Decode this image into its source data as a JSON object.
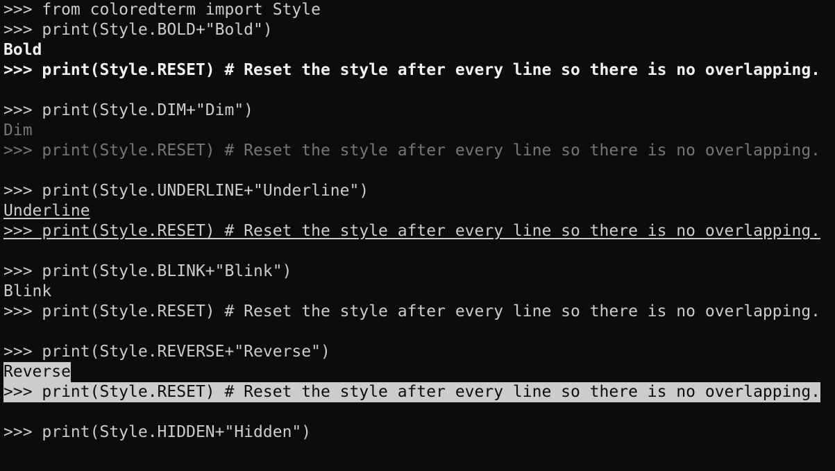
{
  "terminal": {
    "lines": [
      {
        "text": ">>> from coloredterm import Style",
        "style": "normal"
      },
      {
        "text": ">>> print(Style.BOLD+\"Bold\")",
        "style": "normal"
      },
      {
        "text": "Bold",
        "style": "bold"
      },
      {
        "text": ">>> print(Style.RESET) # Reset the style after every line so there is no overlapping.",
        "style": "bold"
      },
      {
        "text": "",
        "style": "normal"
      },
      {
        "text": ">>> print(Style.DIM+\"Dim\")",
        "style": "normal"
      },
      {
        "text": "Dim",
        "style": "dim"
      },
      {
        "text": ">>> print(Style.RESET) # Reset the style after every line so there is no overlapping.",
        "style": "dim"
      },
      {
        "text": "",
        "style": "normal"
      },
      {
        "text": ">>> print(Style.UNDERLINE+\"Underline\")",
        "style": "normal"
      },
      {
        "text": "Underline",
        "style": "underline"
      },
      {
        "text": ">>> print(Style.RESET) # Reset the style after every line so there is no overlapping.",
        "style": "underline"
      },
      {
        "text": "",
        "style": "normal"
      },
      {
        "text": ">>> print(Style.BLINK+\"Blink\")",
        "style": "normal"
      },
      {
        "text": "Blink",
        "style": "normal"
      },
      {
        "text": ">>> print(Style.RESET) # Reset the style after every line so there is no overlapping.",
        "style": "normal"
      },
      {
        "text": "",
        "style": "normal"
      },
      {
        "text": ">>> print(Style.REVERSE+\"Reverse\")",
        "style": "normal"
      },
      {
        "text": "Reverse",
        "style": "reverse"
      },
      {
        "text": ">>> print(Style.RESET) # Reset the style after every line so there is no overlapping.",
        "style": "reverse"
      },
      {
        "text": "",
        "style": "normal"
      },
      {
        "text": ">>> print(Style.HIDDEN+\"Hidden\")",
        "style": "normal"
      }
    ]
  },
  "colors": {
    "background": "#0c0c0c",
    "foreground": "#cccccc",
    "bold": "#f2f2f2",
    "dim": "#767676",
    "reverse_bg": "#cccccc"
  }
}
